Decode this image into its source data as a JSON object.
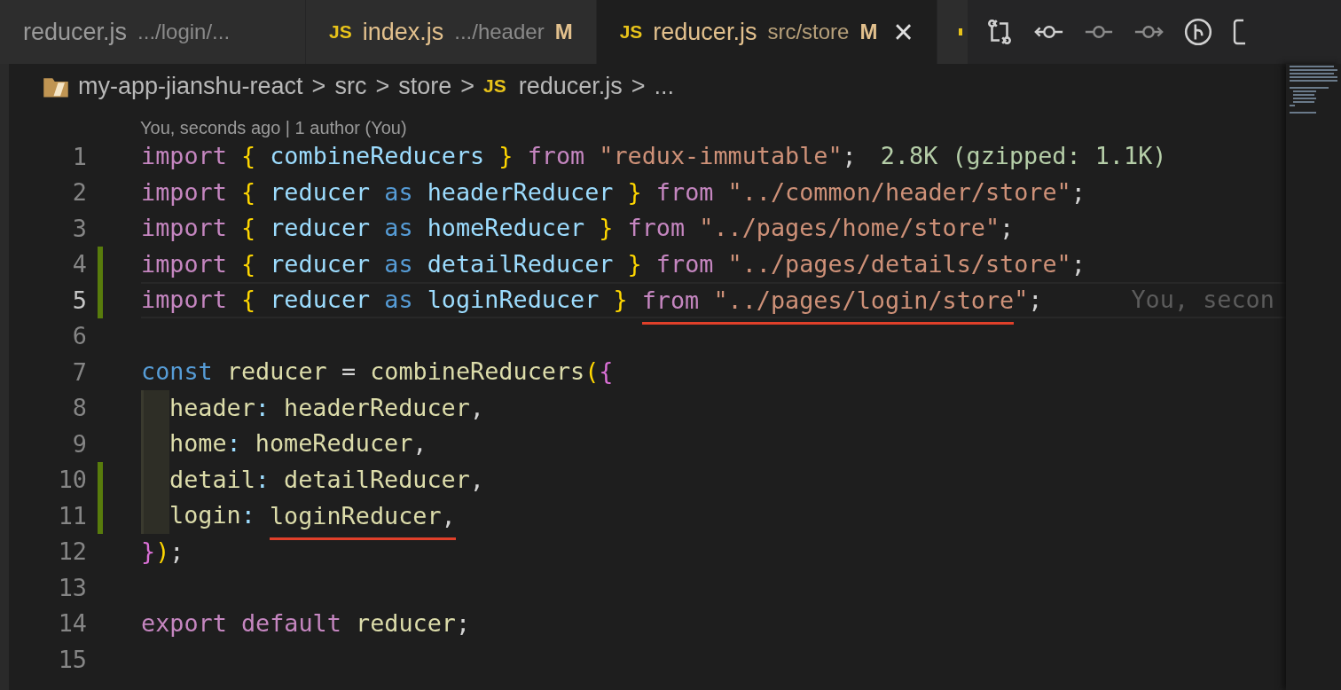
{
  "tabs": [
    {
      "label": "reducer.js",
      "description": ".../login/...",
      "modified": false,
      "selected": false,
      "kind": "plain"
    },
    {
      "label": "index.js",
      "description": ".../header",
      "modified": true,
      "modified_mark": "M",
      "selected": false,
      "kind": "js",
      "icon_text": "JS"
    },
    {
      "label": "reducer.js",
      "description": "src/store",
      "modified": true,
      "modified_mark": "M",
      "selected": true,
      "kind": "js",
      "icon_text": "JS",
      "close": "×"
    },
    {
      "selected": false,
      "kind": "partial"
    }
  ],
  "toolbar": [
    {
      "kind": "compare",
      "disabled": false
    },
    {
      "kind": "previous",
      "disabled": false
    },
    {
      "kind": "commit",
      "disabled": true
    },
    {
      "kind": "next",
      "disabled": true
    },
    {
      "kind": "graph",
      "disabled": false
    },
    {
      "kind": "split",
      "disabled": false
    }
  ],
  "breadcrumb": [
    {
      "kind": "folder",
      "label": "my-app-jianshu-react"
    },
    {
      "kind": "text",
      "label": "src"
    },
    {
      "kind": "text",
      "label": "store"
    },
    {
      "kind": "js",
      "icon_text": "JS",
      "label": "reducer.js"
    },
    {
      "kind": "text",
      "label": "..."
    }
  ],
  "breadcrumb_separator": ">",
  "codelens": "You, seconds ago | 1 author (You)",
  "lines": [
    {
      "num": "1",
      "changed": false,
      "current": false,
      "indented": false,
      "parts": [
        {
          "marked": false,
          "tokens": [
            {
              "kind": "kw",
              "t": "import"
            },
            {
              "kind": "b1",
              "t": " {"
            },
            {
              "kind": "var",
              "t": " combineReducers"
            },
            {
              "kind": "b1",
              "t": " }"
            },
            {
              "kind": "kw",
              "t": " from"
            },
            {
              "kind": "str",
              "t": " \"redux-immutable\""
            },
            {
              "kind": "plain",
              "t": ";"
            }
          ]
        }
      ],
      "inlay": "2.8K (gzipped: 1.1K)"
    },
    {
      "num": "2",
      "changed": false,
      "current": false,
      "indented": false,
      "parts": [
        {
          "marked": false,
          "tokens": [
            {
              "kind": "kw",
              "t": "import"
            },
            {
              "kind": "b1",
              "t": " {"
            },
            {
              "kind": "var",
              "t": " reducer"
            },
            {
              "kind": "storage",
              "t": " as"
            },
            {
              "kind": "var",
              "t": " headerReducer"
            },
            {
              "kind": "b1",
              "t": " }"
            },
            {
              "kind": "kw",
              "t": " from"
            },
            {
              "kind": "str",
              "t": " \"../common/header/store\""
            },
            {
              "kind": "plain",
              "t": ";"
            }
          ]
        }
      ]
    },
    {
      "num": "3",
      "changed": false,
      "current": false,
      "indented": false,
      "parts": [
        {
          "marked": false,
          "tokens": [
            {
              "kind": "kw",
              "t": "import"
            },
            {
              "kind": "b1",
              "t": " {"
            },
            {
              "kind": "var",
              "t": " reducer"
            },
            {
              "kind": "storage",
              "t": " as"
            },
            {
              "kind": "var",
              "t": " homeReducer"
            },
            {
              "kind": "b1",
              "t": " }"
            },
            {
              "kind": "kw",
              "t": " from"
            },
            {
              "kind": "str",
              "t": " \"../pages/home/store\""
            },
            {
              "kind": "plain",
              "t": ";"
            }
          ]
        }
      ]
    },
    {
      "num": "4",
      "changed": true,
      "current": false,
      "indented": false,
      "parts": [
        {
          "marked": false,
          "tokens": [
            {
              "kind": "kw",
              "t": "import"
            },
            {
              "kind": "b1",
              "t": " {"
            },
            {
              "kind": "var",
              "t": " reducer"
            },
            {
              "kind": "storage",
              "t": " as"
            },
            {
              "kind": "var",
              "t": " detailReducer"
            },
            {
              "kind": "b1",
              "t": " }"
            },
            {
              "kind": "kw",
              "t": " from"
            },
            {
              "kind": "str",
              "t": " \"../pages/details/store\""
            },
            {
              "kind": "plain",
              "t": ";"
            }
          ]
        }
      ]
    },
    {
      "num": "5",
      "changed": true,
      "current": true,
      "indented": false,
      "parts": [
        {
          "marked": false,
          "tokens": [
            {
              "kind": "kw",
              "t": "import"
            },
            {
              "kind": "b1",
              "t": " {"
            },
            {
              "kind": "var",
              "t": " reducer"
            },
            {
              "kind": "storage",
              "t": " as"
            },
            {
              "kind": "var",
              "t": " loginReducer"
            },
            {
              "kind": "b1",
              "t": " } "
            }
          ]
        },
        {
          "marked": true,
          "tokens": [
            {
              "kind": "kw",
              "t": "from"
            },
            {
              "kind": "str",
              "t": " \"../pages/login/store"
            }
          ]
        },
        {
          "marked": false,
          "tokens": [
            {
              "kind": "str",
              "t": "\""
            },
            {
              "kind": "plain",
              "t": ";"
            }
          ]
        }
      ],
      "blame": "You, secon"
    },
    {
      "num": "6",
      "changed": false,
      "current": false,
      "indented": false
    },
    {
      "num": "7",
      "changed": false,
      "current": false,
      "indented": false,
      "parts": [
        {
          "marked": false,
          "tokens": [
            {
              "kind": "storage",
              "t": "const"
            },
            {
              "kind": "fn",
              "t": " reducer"
            },
            {
              "kind": "plain",
              "t": " ="
            },
            {
              "kind": "fn",
              "t": " combineReducers"
            },
            {
              "kind": "b1",
              "t": "("
            },
            {
              "kind": "b2",
              "t": "{"
            }
          ]
        }
      ]
    },
    {
      "num": "8",
      "changed": false,
      "current": false,
      "indented": true,
      "parts": [
        {
          "marked": false,
          "tokens": [
            {
              "kind": "fn",
              "t": "header"
            },
            {
              "kind": "var",
              "t": ":"
            },
            {
              "kind": "fn",
              "t": " headerReducer"
            },
            {
              "kind": "plain",
              "t": ","
            }
          ]
        }
      ]
    },
    {
      "num": "9",
      "changed": false,
      "current": false,
      "indented": true,
      "parts": [
        {
          "marked": false,
          "tokens": [
            {
              "kind": "fn",
              "t": "home"
            },
            {
              "kind": "var",
              "t": ":"
            },
            {
              "kind": "fn",
              "t": " homeReducer"
            },
            {
              "kind": "plain",
              "t": ","
            }
          ]
        }
      ]
    },
    {
      "num": "10",
      "changed": true,
      "current": false,
      "indented": true,
      "parts": [
        {
          "marked": false,
          "tokens": [
            {
              "kind": "fn",
              "t": "detail"
            },
            {
              "kind": "var",
              "t": ":"
            },
            {
              "kind": "fn",
              "t": " detailReducer"
            },
            {
              "kind": "plain",
              "t": ","
            }
          ]
        }
      ]
    },
    {
      "num": "11",
      "changed": true,
      "current": false,
      "indented": true,
      "parts": [
        {
          "marked": false,
          "tokens": [
            {
              "kind": "fn",
              "t": "login"
            },
            {
              "kind": "var",
              "t": ": "
            }
          ]
        },
        {
          "marked": true,
          "tokens": [
            {
              "kind": "fn",
              "t": "loginReducer"
            },
            {
              "kind": "plain",
              "t": ","
            }
          ]
        }
      ]
    },
    {
      "num": "12",
      "changed": false,
      "current": false,
      "indented": false,
      "parts": [
        {
          "marked": false,
          "tokens": [
            {
              "kind": "b2",
              "t": "}"
            },
            {
              "kind": "b1",
              "t": ")"
            },
            {
              "kind": "plain",
              "t": ";"
            }
          ]
        }
      ]
    },
    {
      "num": "13",
      "changed": false,
      "current": false,
      "indented": false
    },
    {
      "num": "14",
      "changed": false,
      "current": false,
      "indented": false,
      "parts": [
        {
          "marked": false,
          "tokens": [
            {
              "kind": "kw",
              "t": "export"
            },
            {
              "kind": "kw",
              "t": " default"
            },
            {
              "kind": "fn",
              "t": " reducer"
            },
            {
              "kind": "plain",
              "t": ";"
            }
          ]
        }
      ]
    },
    {
      "num": "15",
      "changed": false,
      "current": false,
      "indented": false
    }
  ]
}
